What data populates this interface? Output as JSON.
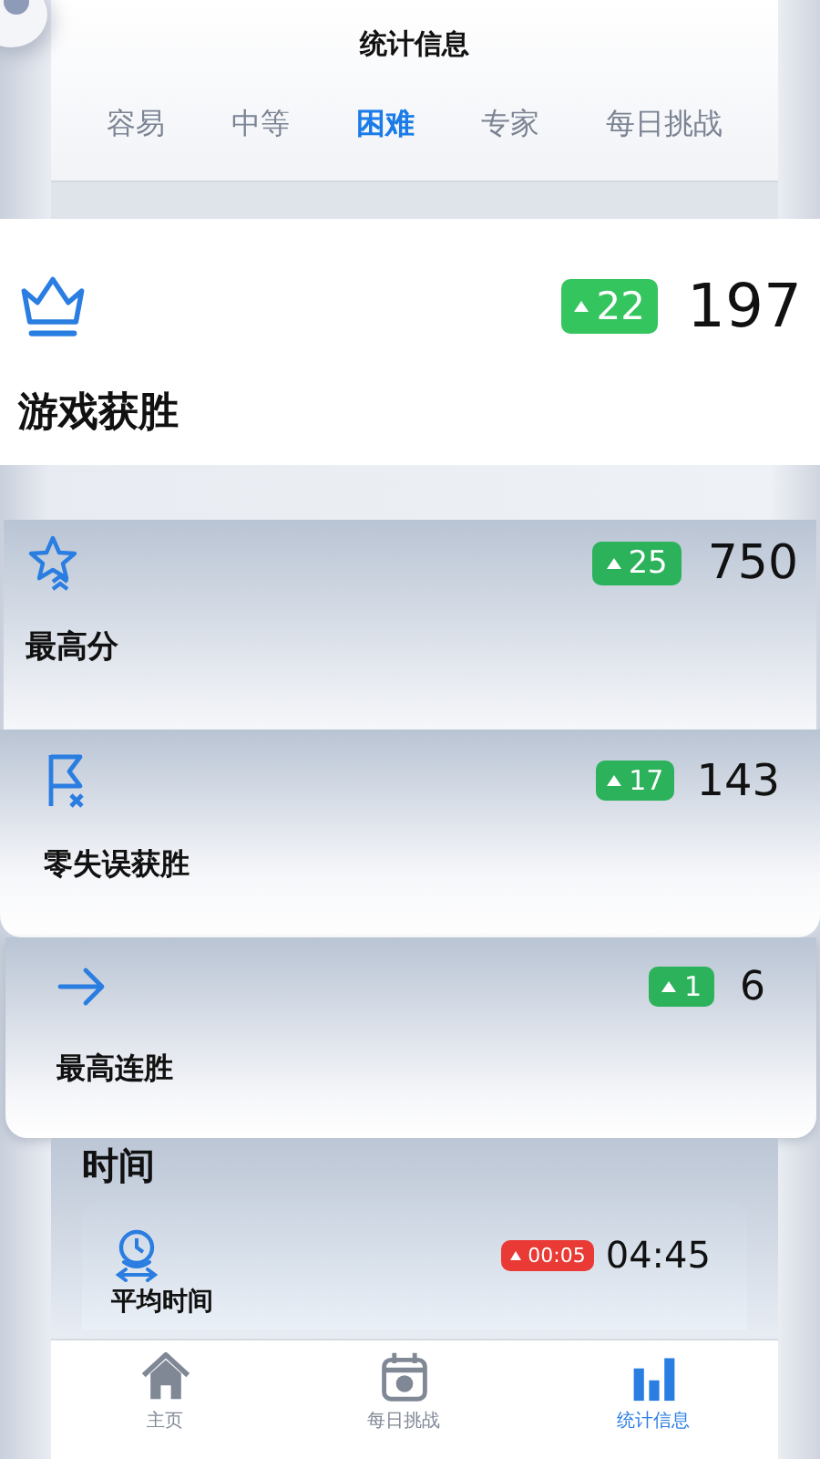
{
  "header": {
    "title": "统计信息"
  },
  "tabs": [
    {
      "label": "容易",
      "selected": false
    },
    {
      "label": "中等",
      "selected": false
    },
    {
      "label": "困难",
      "selected": true
    },
    {
      "label": "专家",
      "selected": false
    },
    {
      "label": "每日挑战",
      "selected": false
    }
  ],
  "stats": [
    {
      "label": "游戏获胜",
      "improved": true,
      "delta": "22",
      "value": "197"
    },
    {
      "label": "最高分",
      "improved": true,
      "delta": "25",
      "value": "750"
    },
    {
      "label": "零失误获胜",
      "improved": true,
      "delta": "17",
      "value": "143"
    },
    {
      "label": "最高连胜",
      "improved": true,
      "delta": "1",
      "value": "6"
    }
  ],
  "time_section": {
    "title": "时间",
    "items": [
      {
        "label": "平均时间",
        "improved": false,
        "delta": "00:05",
        "value": "04:45"
      }
    ]
  },
  "nav": [
    {
      "label": "主页",
      "selected": false
    },
    {
      "label": "每日挑战",
      "selected": false
    },
    {
      "label": "统计信息",
      "selected": true
    }
  ]
}
